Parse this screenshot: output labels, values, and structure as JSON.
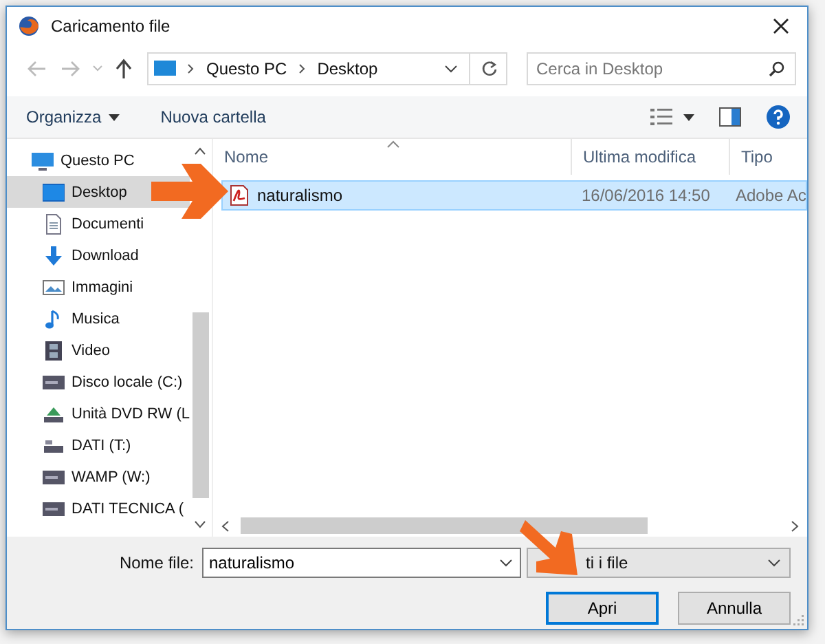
{
  "window": {
    "title": "Caricamento file"
  },
  "address": {
    "segments": [
      "Questo PC",
      "Desktop"
    ]
  },
  "search": {
    "placeholder": "Cerca in Desktop"
  },
  "toolbar": {
    "organize": "Organizza",
    "new_folder": "Nuova cartella"
  },
  "sidebar": {
    "items": [
      {
        "label": "Questo PC",
        "selected": false,
        "children": [
          {
            "label": "Desktop",
            "selected": true
          },
          {
            "label": "Documenti",
            "selected": false
          },
          {
            "label": "Download",
            "selected": false
          },
          {
            "label": "Immagini",
            "selected": false
          },
          {
            "label": "Musica",
            "selected": false
          },
          {
            "label": "Video",
            "selected": false
          },
          {
            "label": "Disco locale (C:)",
            "selected": false
          },
          {
            "label": "Unità DVD RW (L",
            "selected": false
          },
          {
            "label": "DATI  (T:)",
            "selected": false
          },
          {
            "label": "WAMP (W:)",
            "selected": false
          },
          {
            "label": "DATI TECNICA (",
            "selected": false
          }
        ]
      }
    ]
  },
  "table": {
    "columns": [
      "Nome",
      "Ultima modifica",
      "Tipo"
    ],
    "rows": [
      {
        "name": "naturalismo",
        "modified": "16/06/2016 14:50",
        "type": "Adobe Ac",
        "selected": true
      }
    ]
  },
  "filename": {
    "label": "Nome file:",
    "value": "naturalismo"
  },
  "filter": {
    "value": "ti i file"
  },
  "buttons": [
    {
      "label": "Apri",
      "default": true
    },
    {
      "label": "Annulla",
      "default": false
    }
  ]
}
